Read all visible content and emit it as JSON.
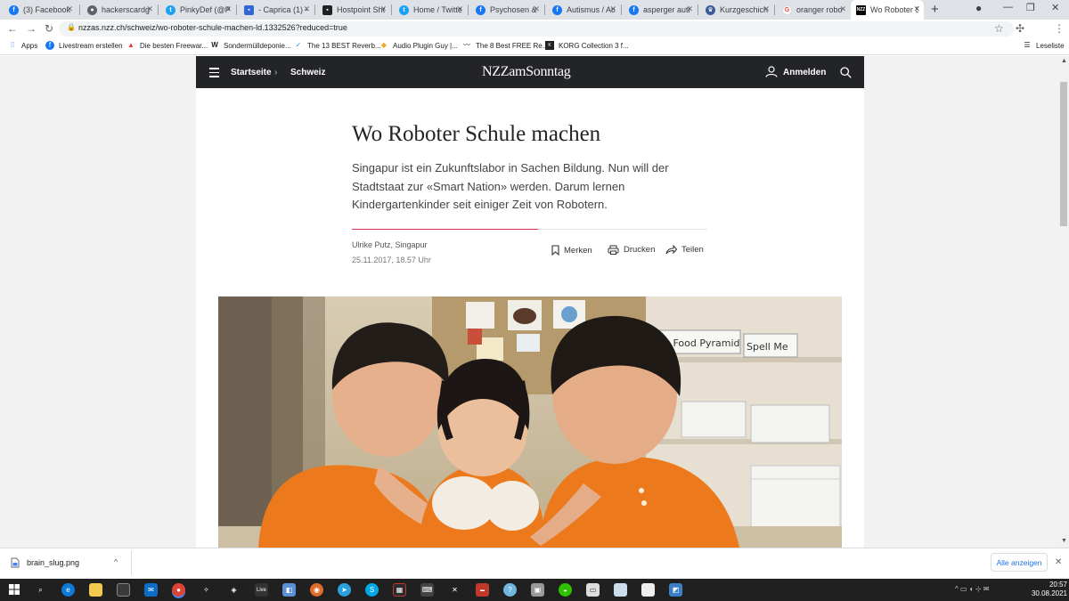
{
  "browser": {
    "tabs": [
      {
        "label": "(3) Facebook",
        "icon": "facebook-icon",
        "color": "#1877f2"
      },
      {
        "label": "hackerscardg",
        "icon": "globe-icon",
        "color": "#5f6368"
      },
      {
        "label": "PinkyDef (@P",
        "icon": "twitter-icon",
        "color": "#1da1f2"
      },
      {
        "label": "- Caprica (1) -",
        "icon": "page-icon",
        "color": "#3367d6"
      },
      {
        "label": "Hostpoint Sho",
        "icon": "page-icon",
        "color": "#202124"
      },
      {
        "label": "Home / Twitte",
        "icon": "twitter-icon",
        "color": "#1da1f2"
      },
      {
        "label": "Psychosen &",
        "icon": "facebook-icon",
        "color": "#1877f2"
      },
      {
        "label": "Autismus / Au",
        "icon": "facebook-icon",
        "color": "#1877f2"
      },
      {
        "label": "asperger auti",
        "icon": "facebook-icon",
        "color": "#1877f2"
      },
      {
        "label": "Kurzgeschich",
        "icon": "crown-icon",
        "color": "#3c5a99"
      },
      {
        "label": "oranger robo",
        "icon": "google-icon",
        "color": "#ea4335"
      },
      {
        "label": "Wo Roboter S",
        "icon": "nzz-icon",
        "color": "#000000"
      }
    ],
    "url": "nzzas.nzz.ch/schweiz/wo-roboter-schule-machen-ld.1332526?reduced=true",
    "bookmarks": [
      {
        "label": "Apps",
        "icon": "apps-grid-icon"
      },
      {
        "label": "Livestream erstellen",
        "icon": "facebook-icon"
      },
      {
        "label": "Die besten Freewar...",
        "icon": "flag-icon"
      },
      {
        "label": "Sondermülldeponie...",
        "icon": "w-icon"
      },
      {
        "label": "The 13 BEST Reverb...",
        "icon": "reverb-icon"
      },
      {
        "label": "Audio Plugin Guy |...",
        "icon": "plugin-icon"
      },
      {
        "label": "The 8 Best FREE Re...",
        "icon": "wave-icon"
      },
      {
        "label": "KORG Collection 3 f...",
        "icon": "korg-icon"
      }
    ],
    "reading_list": "Leseliste"
  },
  "site": {
    "breadcrumb_home": "Startseite",
    "breadcrumb_section": "Schweiz",
    "logo": "NZZamSonntag",
    "login": "Anmelden"
  },
  "article": {
    "title": "Wo Roboter Schule machen",
    "lead": "Singapur ist ein Zukunftslabor in Sachen Bildung. Nun will der Stadtstaat zur «Smart Nation» werden. Darum lernen Kindergartenkinder seit einiger Zeit von Robotern.",
    "author": "Ulrike Putz, Singapur",
    "date": "25.11.2017, 18.57 Uhr",
    "actions": {
      "bookmark": "Merken",
      "print": "Drucken",
      "share": "Teilen"
    },
    "photo_signs": [
      "My Food Pyramid",
      "Spell Me"
    ]
  },
  "downloads": {
    "file": "brain_slug.png",
    "show_all": "Alle anzeigen"
  },
  "taskbar": {
    "time": "20:57",
    "date": "30.08.2021"
  },
  "colors": {
    "nzz_header": "#232428",
    "accent_red": "#e0304a",
    "shirt_orange": "#ec7a1c"
  }
}
